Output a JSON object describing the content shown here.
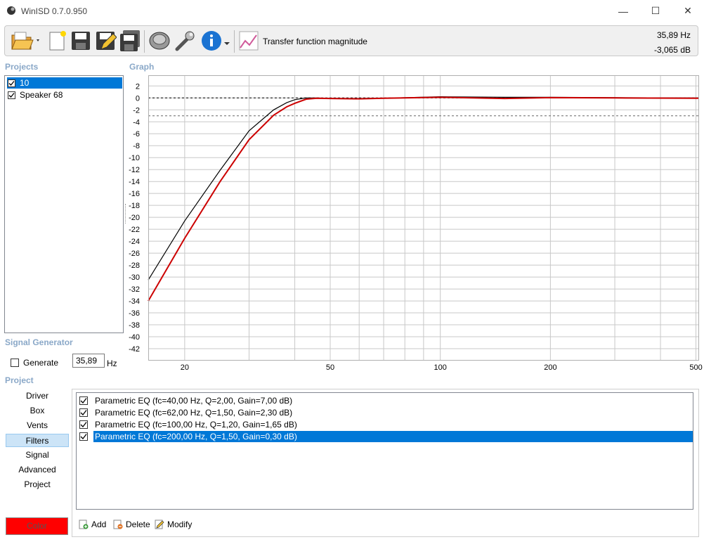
{
  "window": {
    "title": "WinISD 0.7.0.950",
    "minimize_glyph": "—",
    "maximize_glyph": "☐",
    "close_glyph": "✕"
  },
  "toolbar": {
    "icons": [
      "open-folder-icon",
      "new-document-icon",
      "save-icon",
      "save-as-icon",
      "save-all-icon",
      "speaker-driver-icon",
      "wrench-icon",
      "info-icon",
      "graph-icon"
    ],
    "view_label": "Transfer function magnitude",
    "readout_freq": "35,89 Hz",
    "readout_db": "-3,065 dB"
  },
  "projects": {
    "title": "Projects",
    "items": [
      {
        "label": "10",
        "checked": true,
        "selected": true
      },
      {
        "label": "Speaker 68",
        "checked": true,
        "selected": false
      }
    ]
  },
  "graph": {
    "title": "Graph"
  },
  "chart_data": {
    "type": "line",
    "title": "",
    "xlabel": "",
    "ylabel": "",
    "x_scale": "log",
    "xlim": [
      15.9,
      510
    ],
    "ylim": [
      -44,
      3.8
    ],
    "x_ticks": [
      20,
      50,
      100,
      200,
      500
    ],
    "x_ticklabels": [
      "20",
      "50",
      "100",
      "200",
      "500"
    ],
    "y_ticks": [
      2,
      0,
      -2,
      -4,
      -6,
      -8,
      -10,
      -12,
      -14,
      -16,
      -18,
      -20,
      -22,
      -24,
      -26,
      -28,
      -30,
      -32,
      -34,
      -36,
      -38,
      -40,
      -42
    ],
    "reference_lines": [
      0,
      -3
    ],
    "grid": true,
    "series": [
      {
        "color": "#000000",
        "x": [
          15.9,
          20,
          25,
          30,
          35,
          38,
          40,
          43,
          46,
          50,
          60,
          70,
          100,
          150,
          200,
          300,
          510
        ],
        "y": [
          -30.5,
          -20.6,
          -12.1,
          -5.5,
          -2.0,
          -0.8,
          -0.3,
          0.0,
          0.0,
          -0.1,
          -0.1,
          -0.05,
          0.2,
          0.1,
          0.1,
          0.05,
          0.0
        ]
      },
      {
        "color": "#cc0000",
        "x": [
          15.9,
          20,
          25,
          30,
          35,
          38,
          40,
          43,
          46,
          50,
          60,
          70,
          100,
          150,
          200,
          300,
          510
        ],
        "y": [
          -34.0,
          -23.5,
          -14.0,
          -7.0,
          -2.9,
          -1.5,
          -0.9,
          -0.2,
          -0.05,
          -0.1,
          -0.15,
          -0.05,
          0.1,
          -0.1,
          0.05,
          0.0,
          -0.05
        ]
      }
    ]
  },
  "signal_generator": {
    "title": "Signal Generator",
    "generate_label": "Generate",
    "generate_checked": false,
    "frequency": "35,89",
    "unit": "Hz"
  },
  "project_nav": {
    "title": "Project",
    "items": [
      "Driver",
      "Box",
      "Vents",
      "Filters",
      "Signal",
      "Advanced",
      "Project"
    ],
    "selected": "Filters",
    "color_label": "Color",
    "color_value": "#ff0000"
  },
  "filters": {
    "items": [
      {
        "label": "Parametric EQ (fc=40,00 Hz, Q=2,00, Gain=7,00 dB)",
        "checked": true,
        "selected": false
      },
      {
        "label": "Parametric EQ (fc=62,00 Hz, Q=1,50, Gain=2,30 dB)",
        "checked": true,
        "selected": false
      },
      {
        "label": "Parametric EQ (fc=100,00 Hz, Q=1,20, Gain=1,65 dB)",
        "checked": true,
        "selected": false
      },
      {
        "label": "Parametric EQ (fc=200,00 Hz, Q=1,50, Gain=0,30 dB)",
        "checked": true,
        "selected": true
      }
    ],
    "add_label": "Add",
    "delete_label": "Delete",
    "modify_label": "Modify"
  },
  "colors": {
    "accent": "#0078d7",
    "section_title": "#8aa8c8",
    "curve_project": "#cc0000"
  }
}
